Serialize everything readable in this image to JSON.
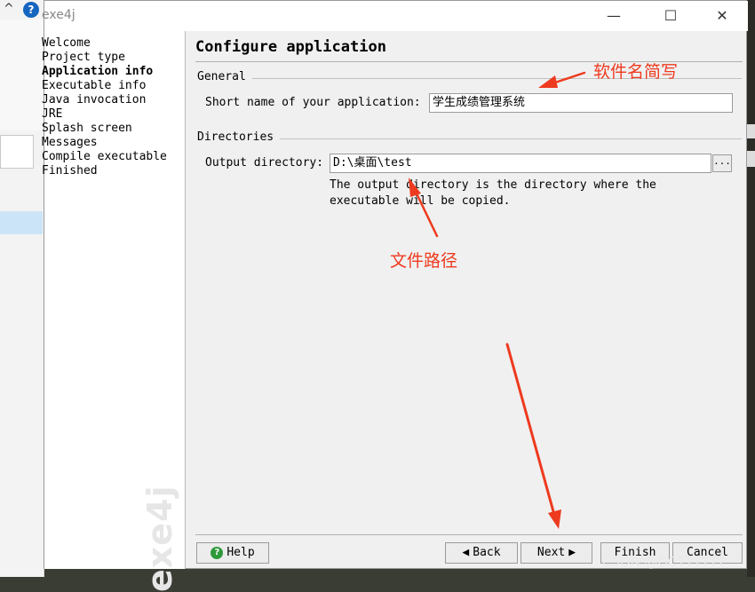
{
  "window": {
    "title": "exe4j",
    "controls": {
      "minimize": "—",
      "maximize": "☐",
      "close": "✕"
    }
  },
  "steps": [
    {
      "label": "Welcome",
      "active": false
    },
    {
      "label": "Project type",
      "active": false
    },
    {
      "label": "Application info",
      "active": true
    },
    {
      "label": "Executable info",
      "active": false
    },
    {
      "label": "Java invocation",
      "active": false
    },
    {
      "label": "JRE",
      "active": false
    },
    {
      "label": "Splash screen",
      "active": false
    },
    {
      "label": "Messages",
      "active": false
    },
    {
      "label": "Compile executable",
      "active": false
    },
    {
      "label": "Finished",
      "active": false
    }
  ],
  "watermark": "exe4j",
  "page": {
    "heading": "Configure application",
    "general": {
      "group_label": "General",
      "short_name_label": "Short name of your application:",
      "short_name_value": "学生成绩管理系统"
    },
    "directories": {
      "group_label": "Directories",
      "output_label": "Output directory:",
      "output_value": "D:\\桌面\\test",
      "browse_label": "...",
      "hint_line1": "The output directory is the directory where the",
      "hint_line2": "executable will be copied."
    }
  },
  "buttons": {
    "help": "Help",
    "back": "Back",
    "next": "Next",
    "finish": "Finish",
    "cancel": "Cancel"
  },
  "annotations": {
    "short_name_note": "软件名简写",
    "path_note": "文件路径",
    "color": "#ee3a1e"
  },
  "credit": "CSDN @GCTTTTTT",
  "background": {
    "left_help_icon": "?",
    "left_chevron": "^"
  }
}
